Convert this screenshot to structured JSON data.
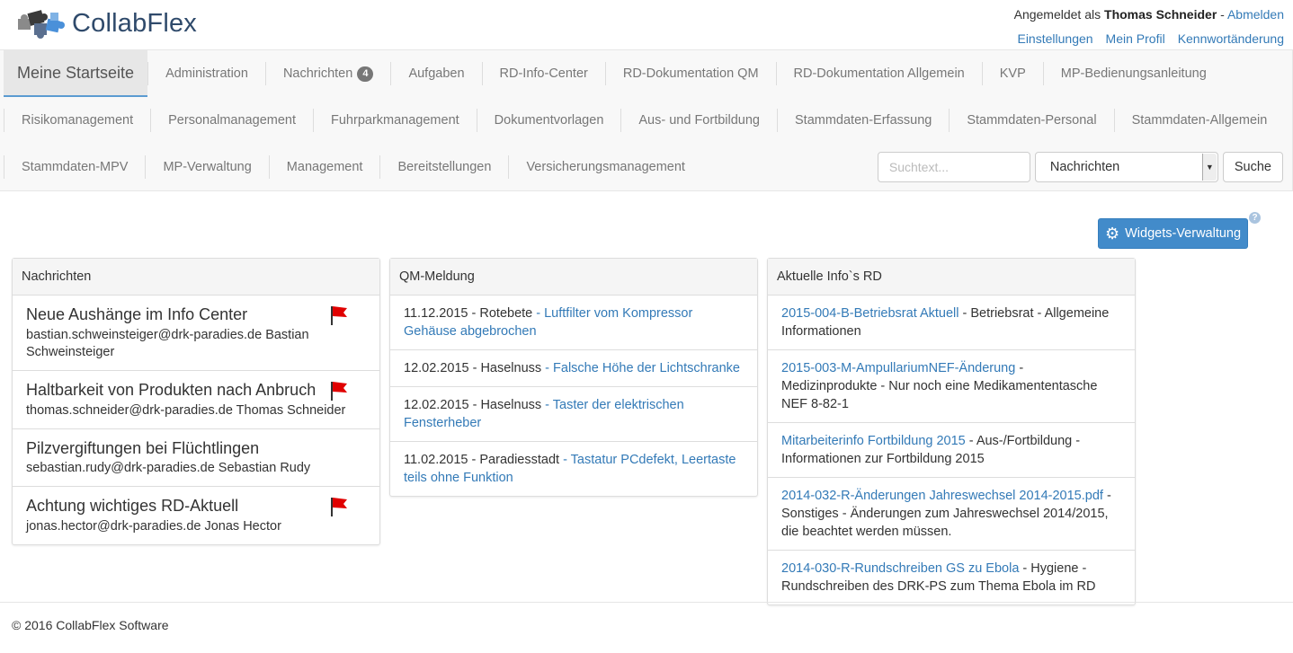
{
  "header": {
    "logo_text": "CollabFlex",
    "logged_in_prefix": "Angemeldet als",
    "user_name": "Thomas Schneider",
    "logout_sep": " - ",
    "logout_label": "Abmelden",
    "links": [
      "Einstellungen",
      "Mein Profil",
      "Kennwortänderung"
    ]
  },
  "nav": {
    "home": "Meine Startseite",
    "row1": [
      "Administration",
      "Nachrichten",
      "Aufgaben",
      "RD-Info-Center",
      "RD-Dokumentation QM",
      "RD-Dokumentation Allgemein",
      "KVP",
      "MP-Bedienungsanleitung"
    ],
    "messages_badge": "4",
    "row2": [
      "Risikomanagement",
      "Personalmanagement",
      "Fuhrparkmanagement",
      "Dokumentvorlagen",
      "Aus- und Fortbildung",
      "Stammdaten-Erfassung",
      "Stammdaten-Personal",
      "Stammdaten-Allgemein"
    ],
    "row3": [
      "Stammdaten-MPV",
      "MP-Verwaltung",
      "Management",
      "Bereitstellungen",
      "Versicherungsmanagement"
    ]
  },
  "search": {
    "placeholder": "Suchtext...",
    "selected": "Nachrichten",
    "button": "Suche"
  },
  "widgets": {
    "button": "Widgets-Verwaltung",
    "help": "?"
  },
  "panels": {
    "messages": {
      "title": "Nachrichten",
      "items": [
        {
          "title": "Neue Aushänge im Info Center",
          "sender": "bastian.schweinsteiger@drk-paradies.de Bastian Schweinsteiger",
          "flag": true
        },
        {
          "title": "Haltbarkeit von Produkten nach Anbruch",
          "sender": "thomas.schneider@drk-paradies.de Thomas Schneider",
          "flag": true
        },
        {
          "title": "Pilzvergiftungen bei Flüchtlingen",
          "sender": "sebastian.rudy@drk-paradies.de Sebastian Rudy",
          "flag": false
        },
        {
          "title": "Achtung wichtiges RD-Aktuell",
          "sender": "jonas.hector@drk-paradies.de Jonas Hector",
          "flag": true
        }
      ]
    },
    "qm": {
      "title": "QM-Meldung",
      "items": [
        {
          "prefix": "11.12.2015 - Rotebete",
          "link": " - Luftfilter vom Kompressor Gehäuse abgebrochen"
        },
        {
          "prefix": "12.02.2015 - Haselnuss",
          "link": " - Falsche Höhe der Lichtschranke"
        },
        {
          "prefix": "12.02.2015 - Haselnuss",
          "link": " - Taster der elektrischen Fensterheber"
        },
        {
          "prefix": "11.02.2015 - Paradiesstadt",
          "link": " - Tastatur PCdefekt, Leertaste teils ohne Funktion"
        }
      ]
    },
    "info": {
      "title": "Aktuelle Info`s RD",
      "items": [
        {
          "link": "2015-004-B-Betriebsrat Aktuell",
          "text": " - Betriebsrat - Allgemeine Informationen"
        },
        {
          "link": "2015-003-M-AmpullariumNEF-Änderung",
          "text": " - Medizinprodukte - Nur noch eine Medikamententasche NEF 8-82-1"
        },
        {
          "link": "Mitarbeiterinfo Fortbildung 2015",
          "text": " - Aus-/Fortbildung - Informationen zur Fortbildung 2015"
        },
        {
          "link": "2014-032-R-Änderungen Jahreswechsel 2014-2015.pdf",
          "text": " - Sonstiges - Änderungen zum Jahreswechsel 2014/2015, die beachtet werden müssen."
        },
        {
          "link": "2014-030-R-Rundschreiben GS zu Ebola",
          "text": " - Hygiene - Rundschreiben des DRK-PS zum Thema Ebola im RD"
        }
      ]
    }
  },
  "footer": {
    "text": "© 2016 CollabFlex Software"
  },
  "colors": {
    "link": "#337ab7",
    "primary_button": "#428bca",
    "flag": "#e00000",
    "nav_active_underline": "#5b9bd1"
  }
}
